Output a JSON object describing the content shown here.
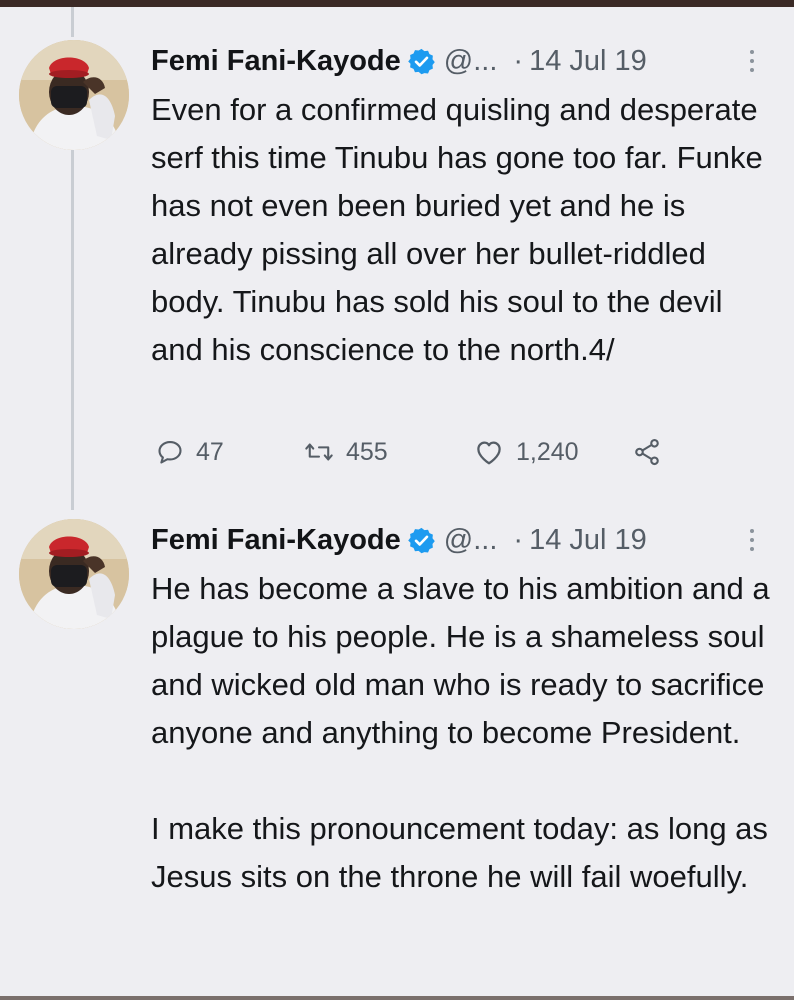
{
  "colors": {
    "verified_badge": "#1d9bf0",
    "secondary_text": "#555d66",
    "thread_line": "#c9cdd3",
    "background": "#eeeef2"
  },
  "tweets": [
    {
      "author": "Femi Fani-Kayode",
      "handle": "@...",
      "separator": "·",
      "date": "14 Jul 19",
      "verified_icon": "verified-badge-icon",
      "avatar": "avatar",
      "paragraphs": [
        "Even for a confirmed quisling and desperate serf this time Tinubu has gone too far. Funke has not even been buried yet and he is already pissing all over her bullet-riddled body. Tinubu has sold his soul to the devil and his conscience to the north.4/"
      ],
      "replies": "47",
      "retweets": "455",
      "likes": "1,240"
    },
    {
      "author": "Femi Fani-Kayode",
      "handle": "@...",
      "separator": "·",
      "date": "14 Jul 19",
      "verified_icon": "verified-badge-icon",
      "avatar": "avatar",
      "paragraphs": [
        "He has become a slave to his ambition and a plague to his people. He is a shameless soul and wicked old man who is ready to sacrifice anyone and anything to become President.",
        "I make this pronouncement today: as long as Jesus sits on the throne he will fail woefully."
      ]
    }
  ]
}
